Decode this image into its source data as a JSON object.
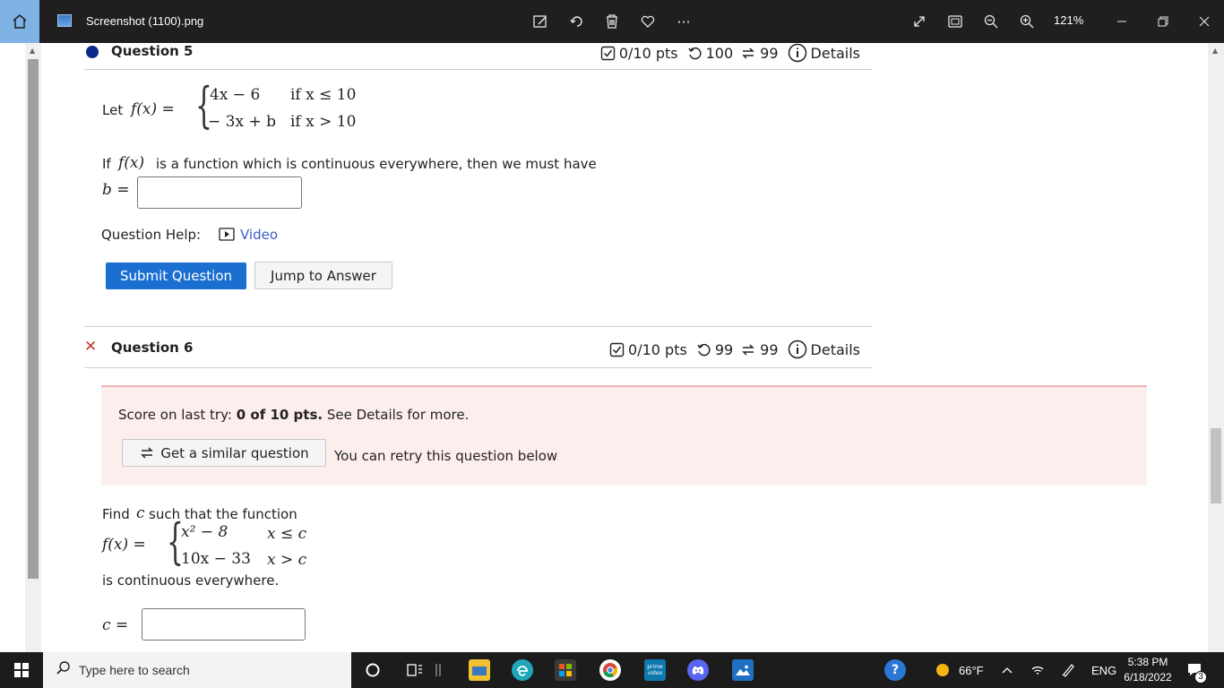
{
  "titlebar": {
    "filename": "Screenshot (1100).png",
    "zoom": "121%",
    "more": "···"
  },
  "q5": {
    "title": "Question 5",
    "pts": "0/10 pts",
    "retries": "100",
    "similar": "99",
    "details": "Details",
    "let": "Let",
    "fx": "f(x) =",
    "case1_expr": "4x − 6",
    "case1_cond": "if  x ≤ 10",
    "case2_expr": "− 3x + b",
    "case2_cond": "if  x > 10",
    "prompt_pre": "If",
    "prompt_fx": "f(x)",
    "prompt_post": "is a function which is continuous everywhere, then we must have",
    "answer_label": "b =",
    "answer_value": "",
    "help_label": "Question Help:",
    "help_video": "Video",
    "submit": "Submit Question",
    "jump": "Jump to Answer"
  },
  "q6": {
    "title": "Question 6",
    "pts": "0/10 pts",
    "retries": "99",
    "similar": "99",
    "details": "Details",
    "score_pre": "Score on last try:",
    "score_bold": "0 of 10 pts.",
    "score_post": "See Details for more.",
    "similar_btn": "Get a similar question",
    "retry_text": "You can retry this question below",
    "find_pre": "Find",
    "find_var": "c",
    "find_post": "such that the function",
    "fx": "f(x) =",
    "case1_expr": "x² − 8",
    "case1_cond": "x ≤ c",
    "case2_expr": "10x − 33",
    "case2_cond": "x > c",
    "continuous": "is continuous everywhere.",
    "answer_label": "c =",
    "answer_value": ""
  },
  "taskbar": {
    "search_placeholder": "Type here to search",
    "temp": "66°F",
    "lang": "ENG",
    "time": "5:38 PM",
    "date": "6/18/2022",
    "notif_count": "3",
    "prime_label": "prime video"
  },
  "colors": {
    "primary_button": "#1b6fd1",
    "alert_bg": "#fdeeee",
    "link": "#3a5ec9",
    "error_x": "#c0392b",
    "question_dot": "#0b2a8c"
  }
}
